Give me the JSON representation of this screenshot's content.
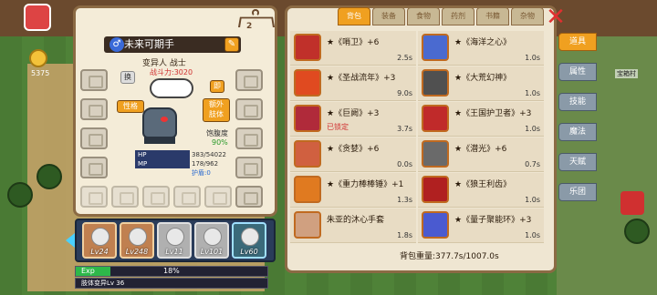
{
  "hud": {
    "gold": "5375",
    "level_badge": ""
  },
  "character": {
    "name": "未来可期手",
    "subtitle": "变异人 战士",
    "power": "战斗力:3020",
    "tag_trait": "性格",
    "tag_swap": "换",
    "tag_set": "即",
    "tag_extra_limb": "额外\n肢体",
    "satiety_label": "饱腹度",
    "satiety_value": "90%",
    "hanger_level": "2",
    "stats": [
      {
        "label": "HP",
        "value": "383/54022"
      },
      {
        "label": "MP",
        "value": "178/962"
      },
      {
        "label": "",
        "value": "护盾:0"
      }
    ]
  },
  "pets": [
    {
      "level": "Lv24",
      "style": "orange"
    },
    {
      "level": "Lv248",
      "style": "orange"
    },
    {
      "level": "Lv11",
      "style": "gray"
    },
    {
      "level": "Lv101",
      "style": "gray"
    },
    {
      "level": "Lv60",
      "style": "teal"
    }
  ],
  "exp": {
    "label": "Exp",
    "percent_text": "18%",
    "fill_fraction": 0.18
  },
  "body_transform": "肢体变异Lv 36",
  "inventory": {
    "tabs": [
      "背包",
      "装备",
      "食物",
      "药剂",
      "书籍",
      "杂物"
    ],
    "active_tab": 0,
    "items_left": [
      {
        "name": "★《哨卫》+6",
        "value": "2.5s",
        "color": "#c0302a",
        "locked": ""
      },
      {
        "name": "★《圣战流年》+3",
        "value": "9.0s",
        "color": "#e04a20",
        "locked": ""
      },
      {
        "name": "★《巨阙》+3",
        "value": "3.7s",
        "color": "#b02a3a",
        "locked": "已锁定"
      },
      {
        "name": "★《贪婪》+6",
        "value": "0.0s",
        "color": "#d06040",
        "locked": ""
      },
      {
        "name": "★《重力棒棒锤》+1",
        "value": "1.3s",
        "color": "#e07a20",
        "locked": ""
      },
      {
        "name": "朱亚的沐心手套",
        "value": "1.8s",
        "color": "#d0a080",
        "locked": ""
      }
    ],
    "items_right": [
      {
        "name": "★《海洋之心》",
        "value": "1.0s",
        "color": "#4a6ad0"
      },
      {
        "name": "★《大荒幻神》",
        "value": "1.0s",
        "color": "#505050"
      },
      {
        "name": "★《王国护卫者》+3",
        "value": "1.0s",
        "color": "#c02a2a"
      },
      {
        "name": "★《潜光》+6",
        "value": "0.7s",
        "color": "#6a6a6a"
      },
      {
        "name": "★《狼王利齿》",
        "value": "1.0s",
        "color": "#b02020"
      },
      {
        "name": "★《量子聚能环》+3",
        "value": "1.0s",
        "color": "#4a5ad0"
      }
    ],
    "weight": "背包重量:377.7s/1007.0s"
  },
  "categories": [
    "道具",
    "属性",
    "技能",
    "魔法",
    "天赋",
    "乐团"
  ],
  "active_category": 0,
  "map_label": "宝箱村",
  "colors": {
    "accent": "#f0a020",
    "panel_border": "#8b6a44",
    "panel_bg": "#efe6d2"
  }
}
